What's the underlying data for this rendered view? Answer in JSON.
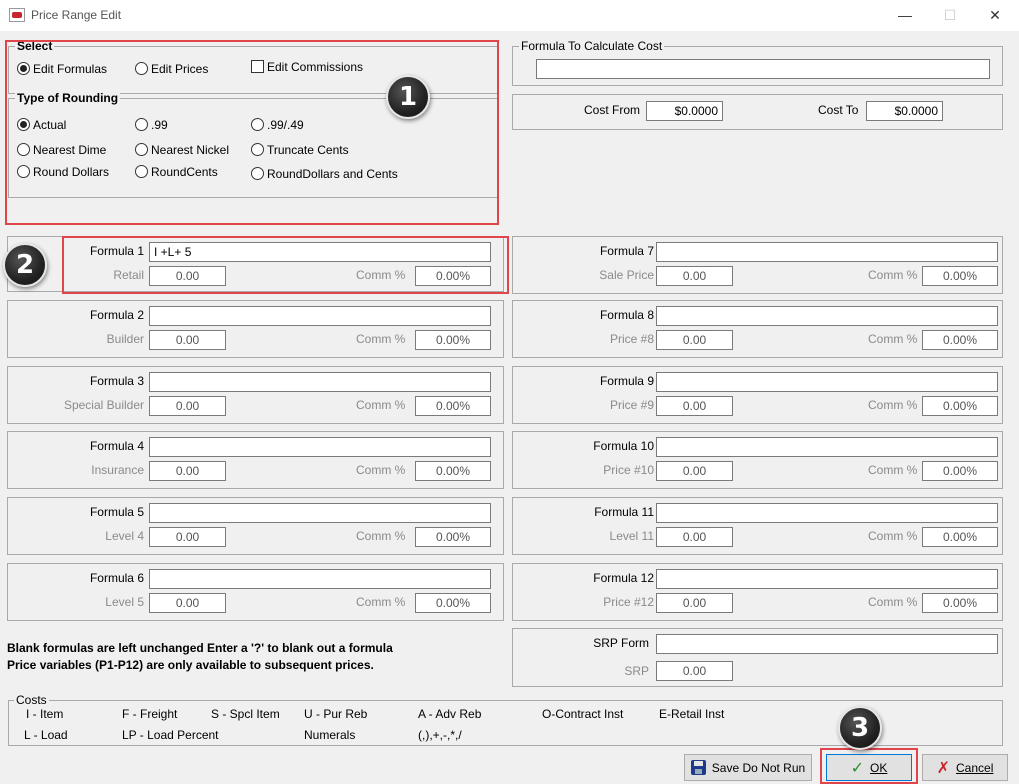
{
  "window": {
    "title": "Price Range Edit",
    "minimize": "—",
    "maximize": "☐",
    "close": "✕"
  },
  "select": {
    "title": "Select",
    "options": [
      "Edit Formulas",
      "Edit Prices"
    ],
    "selected": "Edit Formulas",
    "edit_commissions": "Edit Commissions"
  },
  "rounding": {
    "title": "Type of Rounding",
    "options": [
      "Actual",
      ".99",
      ".99/.49",
      "Nearest Dime",
      "Nearest Nickel",
      "Truncate Cents",
      "Round Dollars",
      "RoundCents",
      "RoundDollars and Cents"
    ],
    "selected": "Actual"
  },
  "cost_formula": {
    "title": "Formula To Calculate Cost",
    "value": ""
  },
  "cost_range": {
    "from_label": "Cost From",
    "from_value": "$0.0000",
    "to_label": "Cost To",
    "to_value": "$0.0000"
  },
  "formulas_left": [
    {
      "label": "Formula 1",
      "value": "I +L+ 5",
      "price_label": "Retail",
      "price": "0.00",
      "comm_label": "Comm %",
      "comm": "0.00%"
    },
    {
      "label": "Formula 2",
      "value": "",
      "price_label": "Builder",
      "price": "0.00",
      "comm_label": "Comm %",
      "comm": "0.00%"
    },
    {
      "label": "Formula 3",
      "value": "",
      "price_label": "Special Builder",
      "price": "0.00",
      "comm_label": "Comm %",
      "comm": "0.00%"
    },
    {
      "label": "Formula 4",
      "value": "",
      "price_label": "Insurance",
      "price": "0.00",
      "comm_label": "Comm %",
      "comm": "0.00%"
    },
    {
      "label": "Formula 5",
      "value": "",
      "price_label": "Level 4",
      "price": "0.00",
      "comm_label": "Comm %",
      "comm": "0.00%"
    },
    {
      "label": "Formula 6",
      "value": "",
      "price_label": "Level 5",
      "price": "0.00",
      "comm_label": "Comm %",
      "comm": "0.00%"
    }
  ],
  "formulas_right": [
    {
      "label": "Formula 7",
      "value": "",
      "price_label": "Sale Price",
      "price": "0.00",
      "comm_label": "Comm %",
      "comm": "0.00%"
    },
    {
      "label": "Formula 8",
      "value": "",
      "price_label": "Price #8",
      "price": "0.00",
      "comm_label": "Comm %",
      "comm": "0.00%"
    },
    {
      "label": "Formula 9",
      "value": "",
      "price_label": "Price #9",
      "price": "0.00",
      "comm_label": "Comm %",
      "comm": "0.00%"
    },
    {
      "label": "Formula 10",
      "value": "",
      "price_label": "Price #10",
      "price": "0.00",
      "comm_label": "Comm %",
      "comm": "0.00%"
    },
    {
      "label": "Formula 11",
      "value": "",
      "price_label": "Level 11",
      "price": "0.00",
      "comm_label": "Comm %",
      "comm": "0.00%"
    },
    {
      "label": "Formula 12",
      "value": "",
      "price_label": "Price #12",
      "price": "0.00",
      "comm_label": "Comm %",
      "comm": "0.00%"
    }
  ],
  "srp": {
    "label": "SRP Form",
    "value": "",
    "price_label": "SRP",
    "price": "0.00"
  },
  "notes": {
    "line1": "Blank formulas are left unchanged  Enter a '?' to blank out a formula",
    "line2": "Price variables (P1-P12) are only available to subsequent prices."
  },
  "costs": {
    "title": "Costs",
    "row1": [
      "I - Item",
      "F - Freight",
      "S - Spcl Item",
      "U - Pur Reb",
      "A - Adv Reb",
      "O-Contract Inst",
      "E-Retail Inst"
    ],
    "row2": [
      "L - Load",
      "LP - Load Percent",
      "Numerals",
      "(,),+,-,*,/"
    ]
  },
  "buttons": {
    "save_do_not_run_prefix": "",
    "save_do_not_run": "Save Do Not Run",
    "ok": "OK",
    "cancel": "Cancel"
  },
  "badges": [
    "1",
    "2",
    "3"
  ],
  "colors": {
    "highlight": "#e0454b",
    "ok_check": "#2d8c2d",
    "cancel_x": "#c8262c",
    "floppy": "#1e3a8a"
  }
}
